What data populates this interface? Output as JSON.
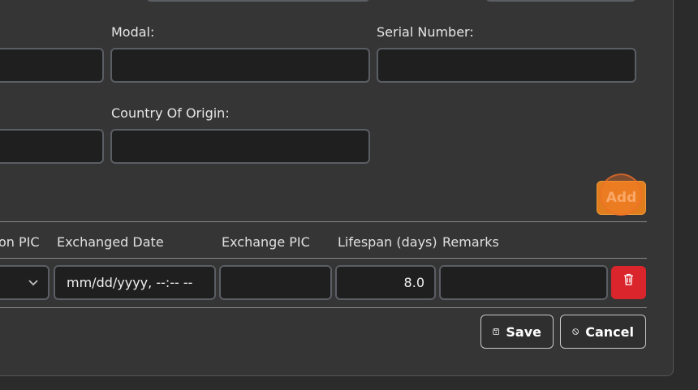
{
  "form": {
    "modal_label": "Modal:",
    "serial_label": "Serial Number:",
    "country_label": "Country Of Origin:",
    "modal_value": "",
    "serial_value": "",
    "country_value": ""
  },
  "add_button": "Add",
  "table": {
    "headers": [
      "on PIC",
      "Exchanged Date",
      "Exchange PIC",
      "Lifespan (days)",
      "Remarks"
    ],
    "row": {
      "exchanged_date": "mm/dd/yyyy, --:-- --",
      "exchange_pic": "",
      "lifespan": "8.0",
      "remarks": ""
    }
  },
  "actions": {
    "save": "Save",
    "cancel": "Cancel"
  },
  "icons": {
    "dropdown": "chevron-down-icon",
    "delete": "trash-icon",
    "save": "floppy-disk-icon",
    "cancel": "ban-icon"
  },
  "colors": {
    "add": "#e07e1e",
    "delete": "#d9252b",
    "background": "#353535"
  }
}
